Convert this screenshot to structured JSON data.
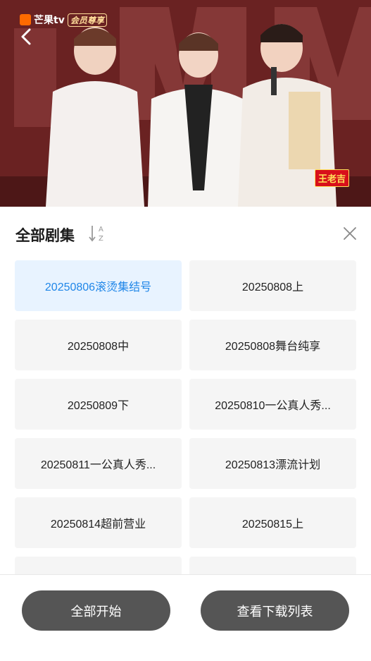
{
  "video": {
    "logo_text": "芒果tv",
    "vip_badge": "会员尊享",
    "corner_badge": "王老吉"
  },
  "panel": {
    "title": "全部剧集",
    "sort_icon": "sort-az-icon",
    "close_icon": "close-icon"
  },
  "episodes": [
    {
      "label": "20250806滚烫集结号",
      "active": true
    },
    {
      "label": "20250808上",
      "active": false
    },
    {
      "label": "20250808中",
      "active": false
    },
    {
      "label": "20250808舞台纯享",
      "active": false
    },
    {
      "label": "20250809下",
      "active": false
    },
    {
      "label": "20250810一公真人秀...",
      "active": false
    },
    {
      "label": "20250811一公真人秀...",
      "active": false
    },
    {
      "label": "20250813漂流计划",
      "active": false
    },
    {
      "label": "20250814超前营业",
      "active": false
    },
    {
      "label": "20250815上",
      "active": false
    },
    {
      "label": "",
      "active": false
    },
    {
      "label": "",
      "active": false
    }
  ],
  "footer": {
    "start_all_label": "全部开始",
    "view_downloads_label": "查看下载列表"
  },
  "colors": {
    "accent": "#1f86e8",
    "active_bg": "#e8f3ff",
    "button_bg": "#555555",
    "tile_bg": "#f5f5f5"
  }
}
